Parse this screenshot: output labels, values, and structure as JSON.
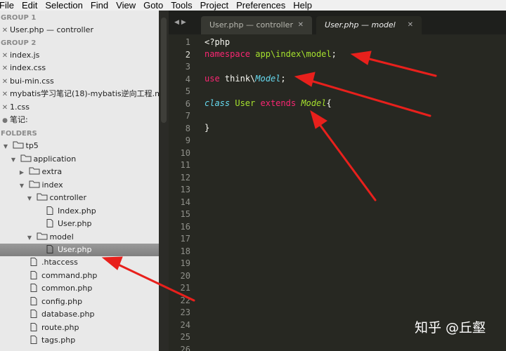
{
  "menu": [
    "File",
    "Edit",
    "Selection",
    "Find",
    "View",
    "Goto",
    "Tools",
    "Project",
    "Preferences",
    "Help"
  ],
  "sidebar": {
    "group1_header": "GROUP 1",
    "group1_files": [
      "User.php — controller"
    ],
    "group2_header": "GROUP 2",
    "group2_files": [
      "index.js",
      "index.css",
      "bui-min.css",
      "mybatis学习笔记(18)-mybatis逆向工程.m",
      "1.css",
      "笔记:"
    ],
    "folders_header": "FOLDERS",
    "tree": {
      "tp5": "tp5",
      "application": "application",
      "extra": "extra",
      "index": "index",
      "controller": "controller",
      "controller_index": "Index.php",
      "controller_user": "User.php",
      "model": "model",
      "model_user": "User.php",
      "htaccess": ".htaccess",
      "command": "command.php",
      "common": "common.php",
      "config": "config.php",
      "database": "database.php",
      "route": "route.php",
      "tags": "tags.php"
    }
  },
  "tabs": [
    {
      "label": "User.php — controller",
      "active": false
    },
    {
      "label": "User.php — model",
      "active": true
    }
  ],
  "editor": {
    "line_numbers": [
      "1",
      "2",
      "3",
      "4",
      "5",
      "6",
      "7",
      "8",
      "9",
      "10",
      "11",
      "12",
      "13",
      "14",
      "15",
      "16",
      "17",
      "18",
      "19",
      "20",
      "21",
      "22",
      "23",
      "24",
      "25",
      "26"
    ],
    "current_line": 2,
    "code": {
      "l1": "<?php",
      "l2_kw": "namespace",
      "l2_ns": "app\\index\\model",
      "l2_end": ";",
      "l4_kw": "use",
      "l4_pre": "think\\",
      "l4_cls": "Model",
      "l4_end": ";",
      "l6_kw": "class",
      "l6_name": "User",
      "l6_ext": "extends",
      "l6_parent": "Model",
      "l6_brace": "{",
      "l8": "}"
    }
  },
  "watermark": "知乎 @丘壑",
  "colors": {
    "editor_bg": "#272822",
    "keyword": "#f92672",
    "namespace": "#a6e22e",
    "italic_type": "#66d9ef",
    "annotation_arrow": "#e8201c",
    "sidebar_bg": "#e9e9e9"
  },
  "icons": [
    "close-icon",
    "folder-icon",
    "file-icon",
    "triangle-expand-icon",
    "triangle-collapse-icon",
    "nav-arrow-left-icon",
    "nav-arrow-right-icon"
  ]
}
